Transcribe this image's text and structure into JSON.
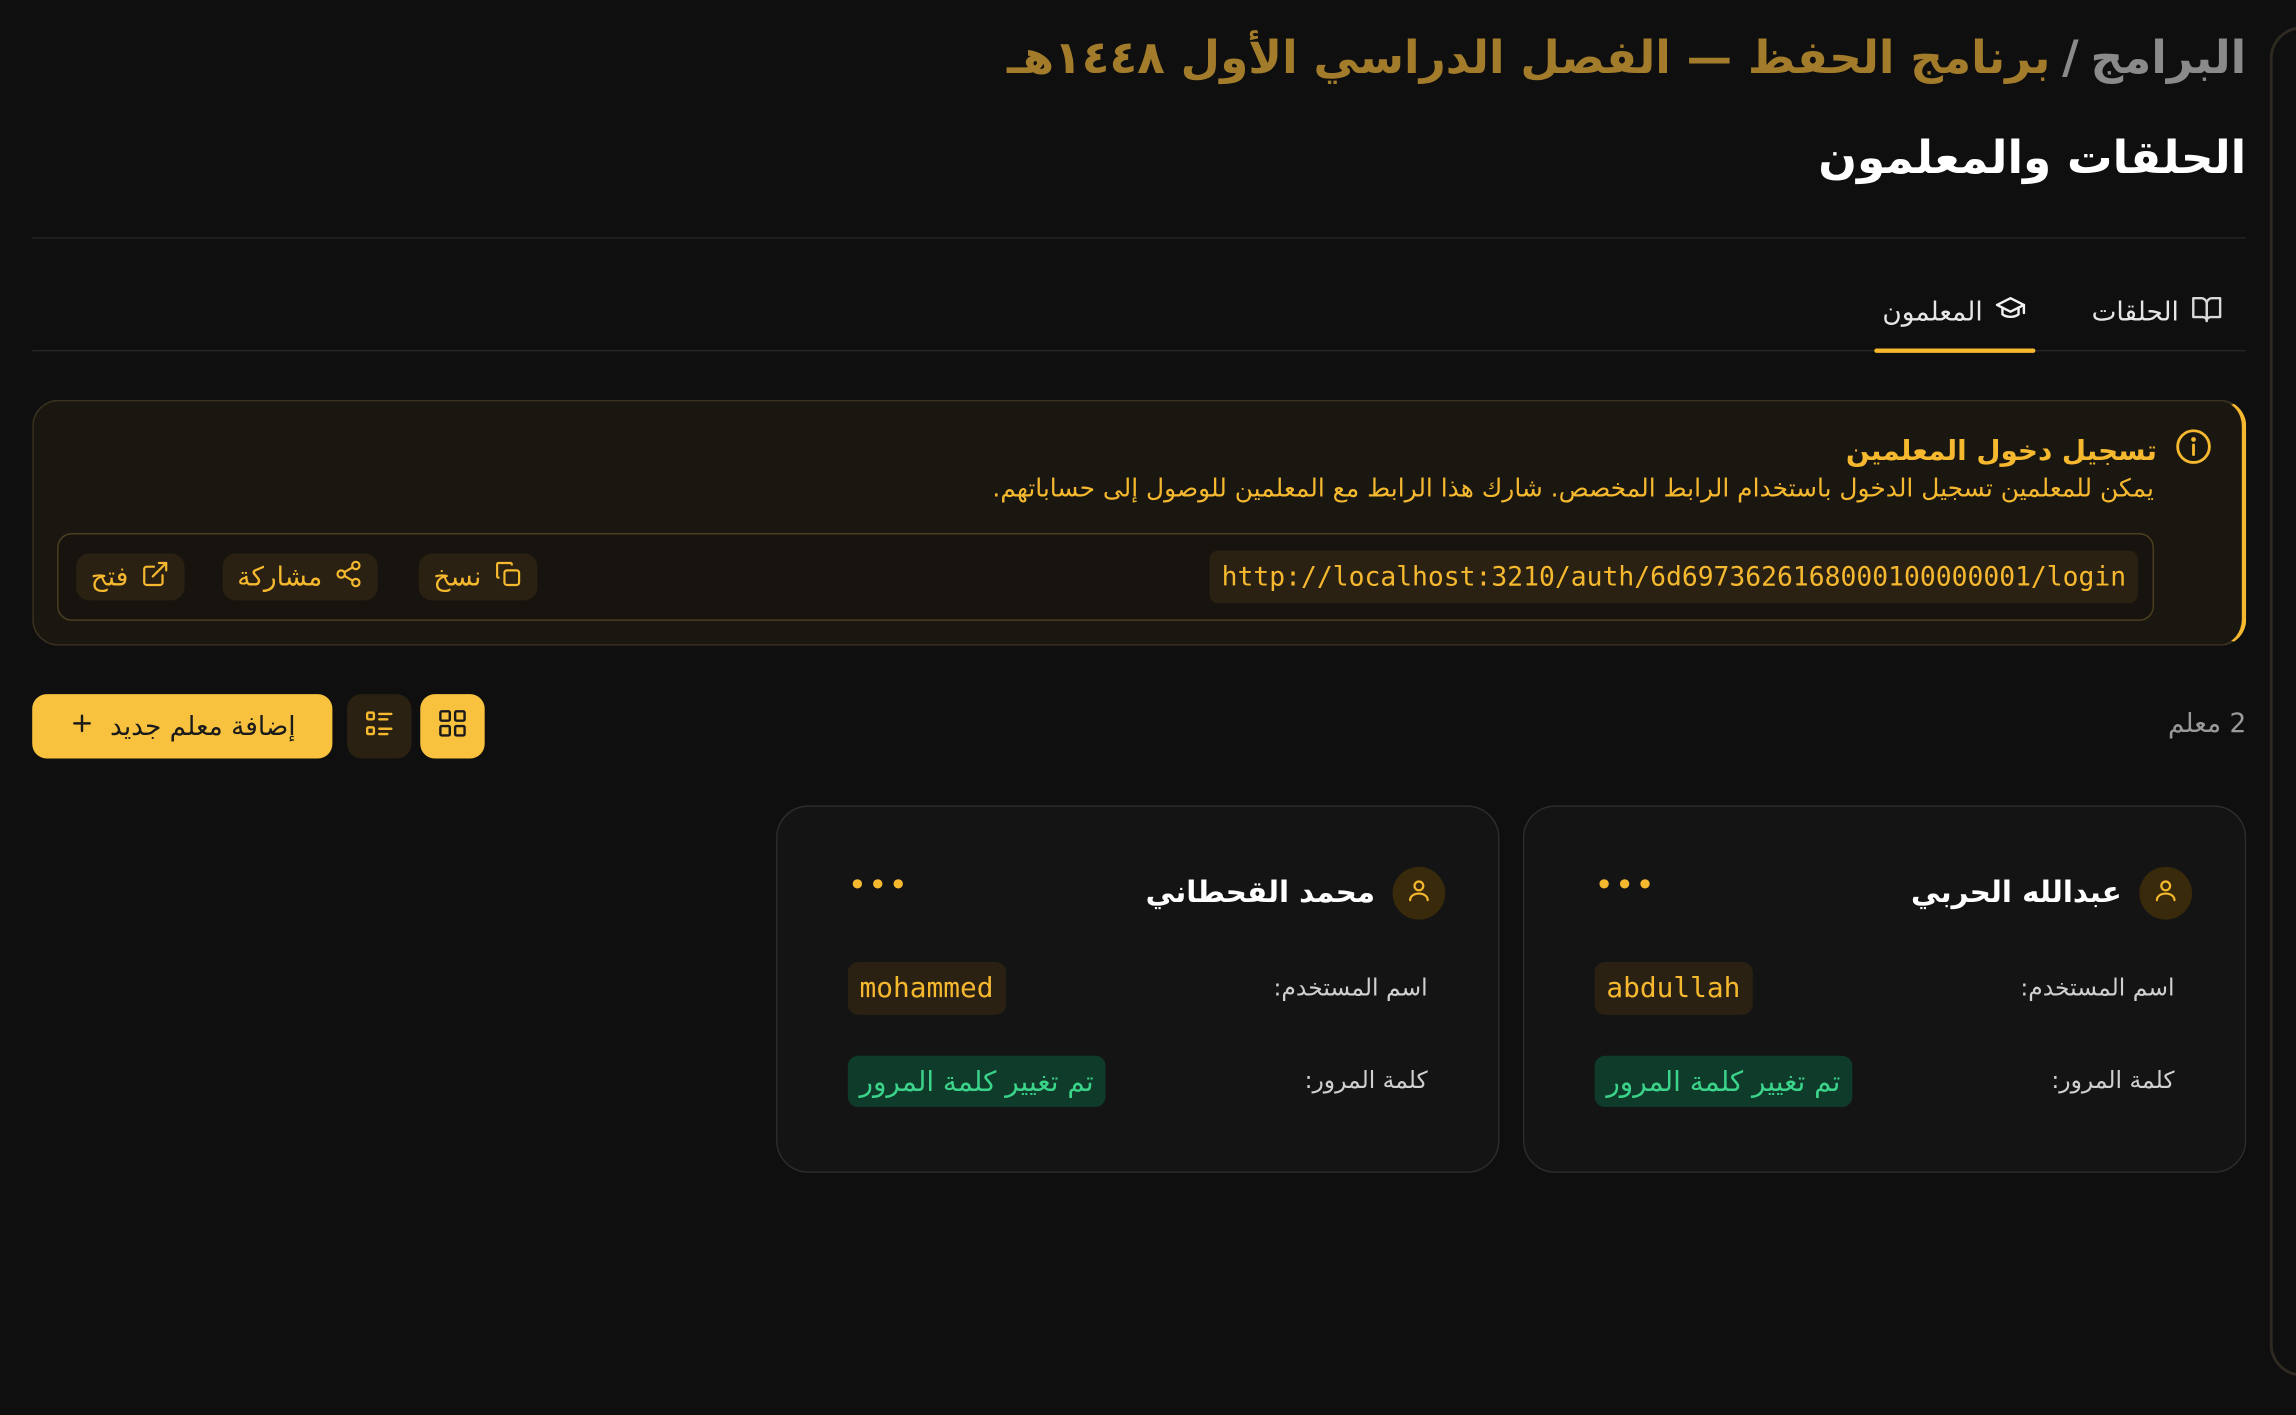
{
  "header": {
    "breadcrumb_root": "البرامج",
    "breadcrumb_sep": "/",
    "breadcrumb_current": "برنامج الحفظ — الفصل الدراسي الأول ١٤٤٨هـ",
    "title": "الحلقات والمعلمون"
  },
  "tabs": [
    {
      "label": "الحلقات",
      "icon": "book-open-icon",
      "active": false
    },
    {
      "label": "المعلمون",
      "icon": "graduation-cap-icon",
      "active": true
    }
  ],
  "login_info": {
    "title": "تسجيل دخول المعلمين",
    "description": "يمكن للمعلمين تسجيل الدخول باستخدام الرابط المخصص. شارك هذا الرابط مع المعلمين للوصول إلى حساباتهم.",
    "url": "http://localhost:3210/auth/6d6973626168000100000001/login",
    "copy_label": "نسخ",
    "share_label": "مشاركة",
    "open_label": "فتح"
  },
  "toolbar": {
    "count_label": "2 معلم",
    "add_label": "إضافة معلم جديد"
  },
  "teachers": [
    {
      "name": "عبدالله الحربي",
      "username_label": "اسم المستخدم:",
      "username": "abdullah",
      "password_label": "كلمة المرور:",
      "password_status": "تم تغيير كلمة المرور"
    },
    {
      "name": "محمد القحطاني",
      "username_label": "اسم المستخدم:",
      "username": "mohammed",
      "password_label": "كلمة المرور:",
      "password_status": "تم تغيير كلمة المرور"
    }
  ],
  "colors": {
    "accent": "#f5b82e",
    "background": "#0f0f0f",
    "success": "#3bd38a"
  }
}
